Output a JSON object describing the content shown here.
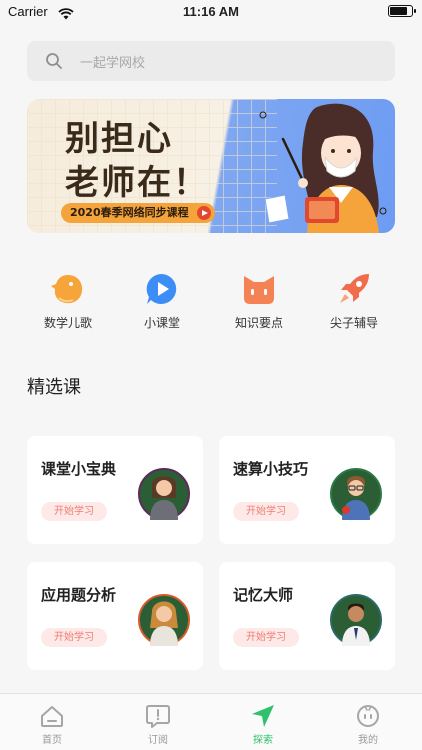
{
  "status_bar": {
    "carrier": "Carrier",
    "time": "11:16 AM",
    "battery_level": 0.85
  },
  "search": {
    "placeholder": "一起学网校"
  },
  "banner": {
    "line1": "别担心",
    "line2": "老师在！",
    "pill": "2020春季网络同步课程"
  },
  "categories": [
    {
      "label": "数学儿歌",
      "icon": "chick-icon",
      "color": "#f6a53a"
    },
    {
      "label": "小课堂",
      "icon": "play-bubble-icon",
      "color": "#3d8df6"
    },
    {
      "label": "知识要点",
      "icon": "cat-face-icon",
      "color": "#f58254"
    },
    {
      "label": "尖子辅导",
      "icon": "rocket-icon",
      "color": "#f06c4a"
    }
  ],
  "section": {
    "title": "精选课"
  },
  "courses": [
    {
      "title": "课堂小宝典",
      "badge": "开始学习",
      "avatar": "teacher-woman-icon"
    },
    {
      "title": "速算小技巧",
      "badge": "开始学习",
      "avatar": "teacher-man-glasses-icon"
    },
    {
      "title": "应用题分析",
      "badge": "开始学习",
      "avatar": "teacher-woman-icon"
    },
    {
      "title": "记忆大师",
      "badge": "开始学习",
      "avatar": "teacher-man-icon"
    }
  ],
  "tabbar": {
    "active_color": "#2fc16b",
    "items": [
      {
        "label": "首页",
        "icon": "home-icon"
      },
      {
        "label": "订阅",
        "icon": "subscribe-icon"
      },
      {
        "label": "探索",
        "icon": "explore-icon",
        "active": true
      },
      {
        "label": "我的",
        "icon": "profile-icon"
      }
    ]
  }
}
